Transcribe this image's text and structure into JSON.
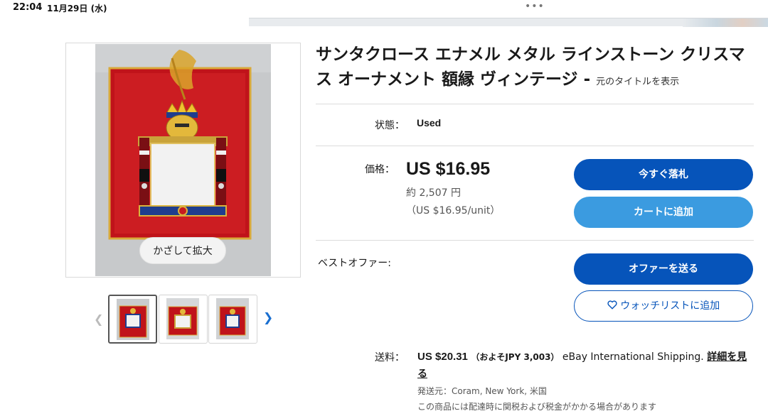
{
  "status_bar": {
    "time": "22:04",
    "date": "11月29日 (水)",
    "dots": "•••"
  },
  "gallery": {
    "zoom_hint": "かざして拡大",
    "prev_icon": "chevron-left-icon",
    "next_icon": "chevron-right-icon",
    "thumbnail_count": 3
  },
  "listing": {
    "title": "サンタクロース エナメル メタル ラインストーン クリスマス オーナメント 額縁 ヴィンテージ",
    "title_separator": "-",
    "show_original_title": "元のタイトルを表示",
    "condition_label": "状態：",
    "condition_value": "Used",
    "price_label": "価格：",
    "price": "US $16.95",
    "price_jpy": "約 2,507 円",
    "unit_price": "（US $16.95/unit）",
    "best_offer_label": "ベストオファー:",
    "shipping_label": "送料：",
    "shipping_price": "US $20.31",
    "shipping_approx": "（およそJPY 3,003）",
    "shipping_service": "eBay International Shipping.",
    "shipping_details_link": "詳細を見る",
    "ships_from": "発送元：Coram, New York, 米国",
    "customs_note": "この商品には配達時に関税および税金がかかる場合があります"
  },
  "buttons": {
    "buy_now": "今すぐ落札",
    "add_to_cart": "カートに追加",
    "make_offer": "オファーを送る",
    "watchlist": "ウォッチリストに追加",
    "watchlist_icon": "heart-icon"
  },
  "colors": {
    "primary_blue": "#0654ba",
    "secondary_blue": "#3b9be0",
    "link_blue": "#1a6fd0"
  }
}
